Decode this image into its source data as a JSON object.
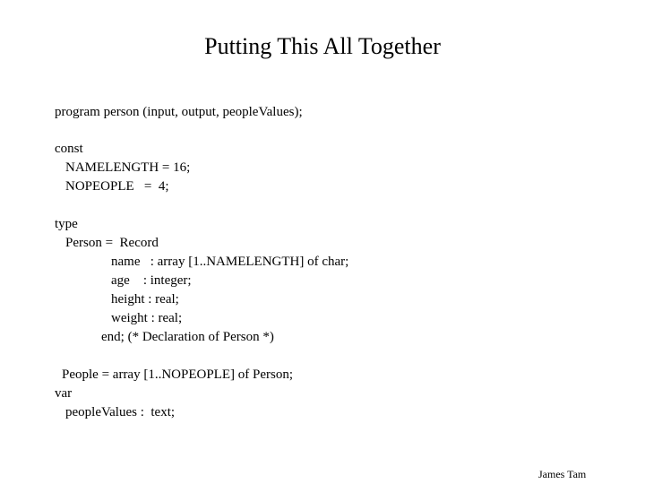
{
  "slide": {
    "title": "Putting This All Together",
    "footer": "James Tam"
  },
  "code": {
    "program_line": "program person (input, output, peopleValues);",
    "const_keyword": "const",
    "const_namelength": "NAMELENGTH = 16;",
    "const_nopeople": "NOPEOPLE   =  4;",
    "type_keyword": "type",
    "record_header": "Person =  Record",
    "field_name": "name   : array [1..NAMELENGTH] of char;",
    "field_age": "age    : integer;",
    "field_height": "height : real;",
    "field_weight": "weight : real;",
    "record_end": "end; (* Declaration of Person *)",
    "people_type": "People = array [1..NOPEOPLE] of Person;",
    "var_keyword": "var",
    "var_decl": "peopleValues :  text;"
  }
}
